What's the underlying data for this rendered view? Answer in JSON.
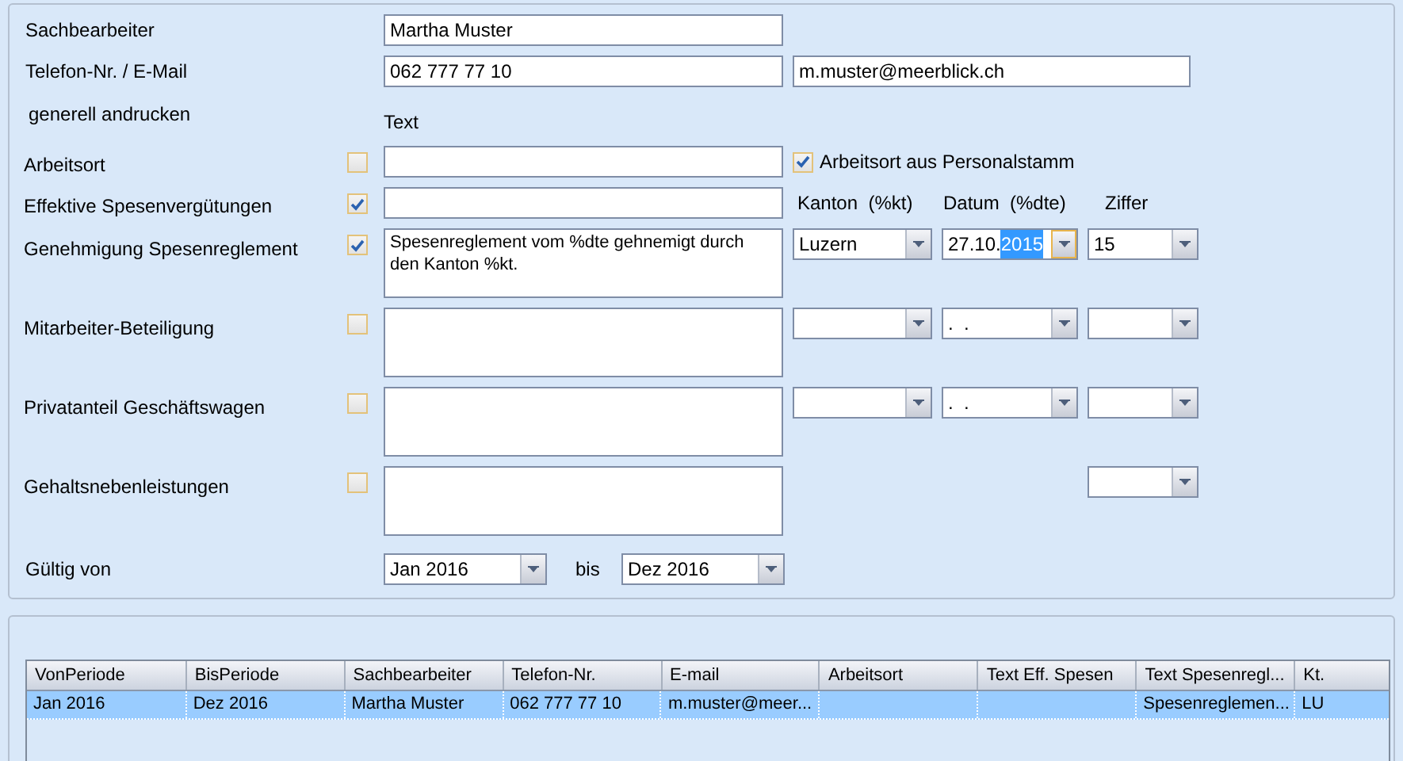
{
  "clerk": {
    "label": "Sachbearbeiter",
    "value": "Martha Muster"
  },
  "contact": {
    "label": "Telefon-Nr. / E-Mail",
    "phone": "062 777 77 10",
    "email": "m.muster@meerblick.ch"
  },
  "print_header": "generell andrucken",
  "text_header": "Text",
  "items": [
    {
      "label": "Arbeitsort",
      "checked": false,
      "kind": "line",
      "option": {
        "label": "Arbeitsort aus Personalstamm",
        "checked": true
      }
    },
    {
      "label": "Effektive Spesenvergütungen",
      "checked": true,
      "kind": "line",
      "column_headers": [
        "Kanton  (%kt)",
        "Datum  (%dte)",
        "Ziffer"
      ]
    },
    {
      "label": "Genehmigung Spesenreglement",
      "checked": true,
      "kind": "multiline",
      "text": "Spesenreglement vom %dte gehnemigt durch den Kanton %kt.",
      "dropdowns": [
        {
          "kind": "canton",
          "value": "Luzern"
        },
        {
          "kind": "date",
          "value": "27.10.",
          "selection": "2015",
          "focused": true
        },
        {
          "kind": "number",
          "value": "15"
        }
      ]
    },
    {
      "label": "Mitarbeiter-Beteiligung",
      "checked": false,
      "kind": "multiline",
      "dropdowns": [
        {
          "kind": "canton"
        },
        {
          "kind": "date",
          "value": ".  .",
          "focused": false
        },
        {
          "kind": "number"
        }
      ]
    },
    {
      "label": "Privatanteil Geschäftswagen",
      "checked": false,
      "kind": "multiline",
      "dropdowns": [
        {
          "kind": "canton"
        },
        {
          "kind": "date",
          "value": ".  .",
          "focused": false
        },
        {
          "kind": "number"
        }
      ]
    },
    {
      "label": "Gehaltsnebenleistungen",
      "checked": false,
      "kind": "multiline",
      "dropdowns": [
        {
          "kind": "number"
        }
      ]
    }
  ],
  "validity": {
    "label": "Gültig von",
    "from": "Jan 2016",
    "to_label": "bis",
    "to": "Dez 2016"
  },
  "table": {
    "columns": [
      "VonPeriode",
      "BisPeriode",
      "Sachbearbeiter",
      "Telefon-Nr.",
      "E-mail",
      "Arbeitsort",
      "Text Eff. Spesen",
      "Text Spesenregl...",
      "Kt."
    ],
    "rows": [
      {
        "selected": true,
        "cells": [
          "Jan 2016",
          "Dez 2016",
          "Martha Muster",
          "062 777 77 10",
          "m.muster@meer...",
          "",
          "",
          "Spesenreglemen...",
          "LU"
        ]
      }
    ]
  }
}
